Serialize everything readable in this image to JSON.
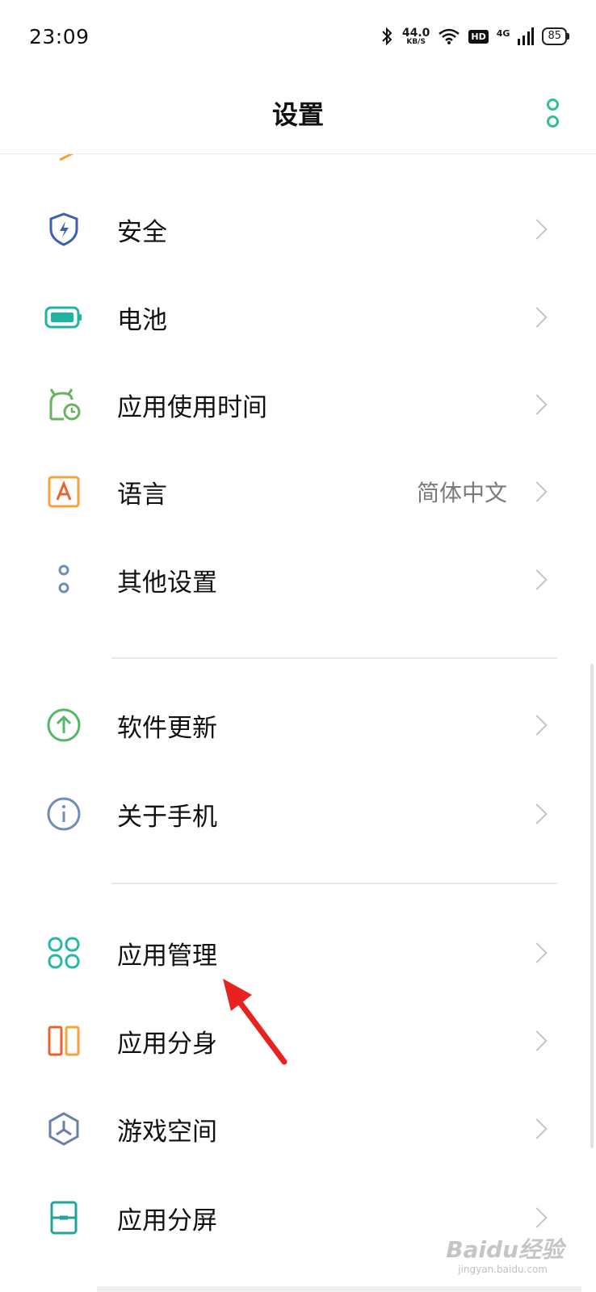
{
  "status_bar": {
    "time": "23:09",
    "speed_value": "44.0",
    "speed_unit": "KB/S",
    "hd_label": "HD",
    "network_label": "4G",
    "battery_level": "85",
    "icons": [
      "bluetooth-icon",
      "wifi-icon",
      "signal-icon",
      "battery-icon"
    ]
  },
  "header": {
    "title": "设置",
    "more_icon": "more-vertical-icon",
    "accent_color": "#2fc38c"
  },
  "settings": {
    "items": [
      {
        "label": "安全",
        "icon": "shield-icon",
        "color": "#3b5fb3"
      },
      {
        "label": "电池",
        "icon": "battery-icon",
        "color": "#1fb5a0"
      },
      {
        "label": "应用使用时间",
        "icon": "app-usage-time-icon",
        "color": "#68b35d"
      },
      {
        "label": "语言",
        "value": "简体中文",
        "icon": "language-icon",
        "color": "#f2a33a"
      },
      {
        "label": "其他设置",
        "icon": "other-settings-icon",
        "color": "#6f8db8"
      },
      {
        "label": "软件更新",
        "icon": "software-update-icon",
        "color": "#53b86a"
      },
      {
        "label": "关于手机",
        "icon": "about-phone-icon",
        "color": "#6f8db8"
      },
      {
        "label": "应用管理",
        "icon": "app-management-icon",
        "color": "#26b8a5"
      },
      {
        "label": "应用分身",
        "icon": "app-clone-icon",
        "color": "#ee7b3c"
      },
      {
        "label": "游戏空间",
        "icon": "game-space-icon",
        "color": "#6a7fa8"
      },
      {
        "label": "应用分屏",
        "icon": "split-screen-icon",
        "color": "#1fa39a"
      }
    ]
  },
  "annotation": {
    "arrow_color": "#e8231f"
  },
  "watermark": {
    "text": "Baidu经验",
    "sub": "jingyan.baidu.com"
  }
}
